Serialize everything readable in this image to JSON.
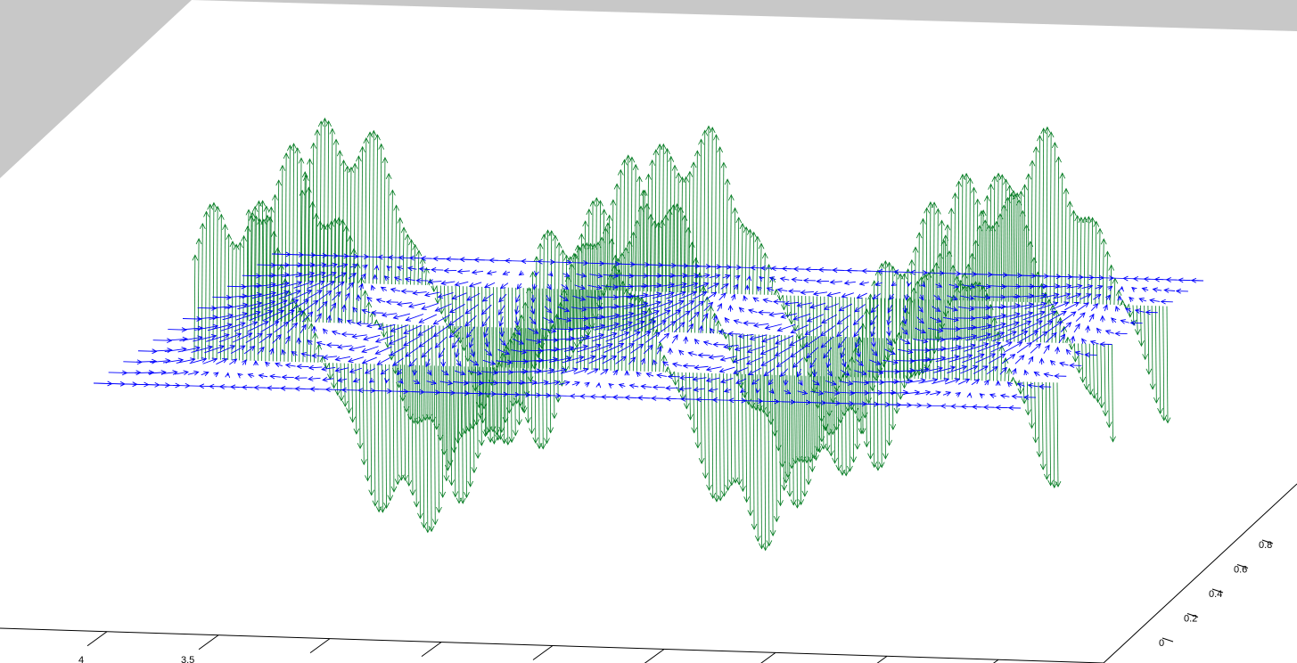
{
  "chart_data": {
    "type": "quiver3d",
    "title": "",
    "xlabel": "",
    "ylabel": "",
    "zlabel": "",
    "grid": false,
    "legend": "none",
    "colors": {
      "background": "#c8c8c8",
      "axes_face": "#ffffff",
      "field_arrows": "#0000ff",
      "wave_arrows": "#007a1f"
    },
    "x_ticks": [
      "4",
      "3.5"
    ],
    "y_ticks": [
      "0",
      "0.2",
      "0.4",
      "0.6",
      "0.8"
    ],
    "series": [
      {
        "kind": "vertical_arrows",
        "description_values": {
          "cycles_visible": 2.5,
          "amplitude": 1.0
        }
      },
      {
        "kind": "planar_vector_field",
        "description_values": {
          "cycles_visible": 2.5
        }
      }
    ]
  }
}
